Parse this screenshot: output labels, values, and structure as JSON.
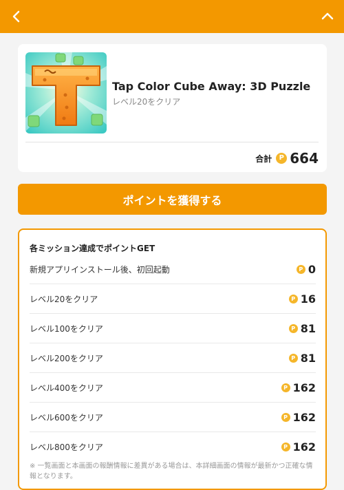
{
  "header": {
    "back_icon": "chevron-left-icon",
    "collapse_icon": "chevron-up-icon",
    "color": "#f39800"
  },
  "app": {
    "title": "Tap Color Cube Away: 3D Puzzle",
    "subtitle": "レベル20をクリア",
    "total_label": "合計",
    "total_value": "664",
    "coin_symbol": "P"
  },
  "cta": {
    "label": "ポイントを獲得する"
  },
  "missions": {
    "heading": "各ミッション達成でポイントGET",
    "items": [
      {
        "label": "新規アプリインストール後、初回起動",
        "points": "0"
      },
      {
        "label": "レベル20をクリア",
        "points": "16"
      },
      {
        "label": "レベル100をクリア",
        "points": "81"
      },
      {
        "label": "レベル200をクリア",
        "points": "81"
      },
      {
        "label": "レベル400をクリア",
        "points": "162"
      },
      {
        "label": "レベル600をクリア",
        "points": "162"
      },
      {
        "label": "レベル800をクリア",
        "points": "162"
      }
    ],
    "note": "※ 一覧画面と本画面の報酬情報に差異がある場合は、本詳細画面の情報が最新かつ正確な情報となります。"
  }
}
